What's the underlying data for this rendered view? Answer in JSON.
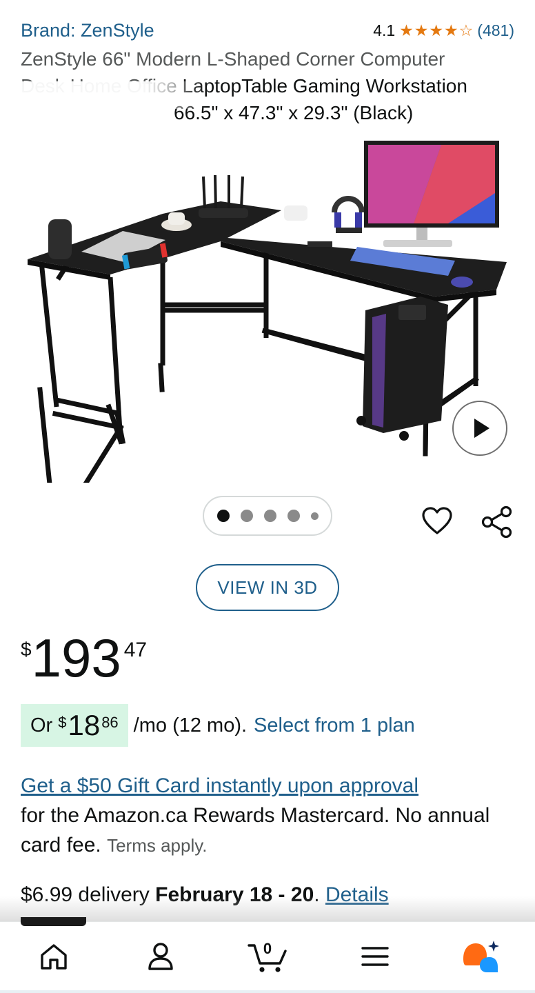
{
  "header": {
    "brand_link": "Brand: ZenStyle",
    "rating_value": "4.1",
    "rating_stars": 4.1,
    "rating_count": "(481)",
    "title_line1": "ZenStyle 66\" Modern L-Shaped Corner Computer",
    "title_line2_grey": "Desk Home Office ",
    "title_line2_dark": "LaptopTable Gaming Workstation",
    "title_line3": "66.5\" x 47.3\" x 29.3\" (Black)"
  },
  "gallery": {
    "image_icon": "l-shaped-desk-product-image",
    "play_icon": "play-icon",
    "dots_total": 5,
    "dots_active_index": 0,
    "favorite_icon": "heart-icon",
    "share_icon": "share-icon",
    "view_3d_label": "VIEW IN 3D"
  },
  "price": {
    "currency": "$",
    "whole": "193",
    "fraction": "47"
  },
  "installment": {
    "or_label": "Or",
    "currency": "$",
    "whole": "18",
    "fraction": "86",
    "term_text": "/mo (12 mo).",
    "plan_link": "Select from 1 plan"
  },
  "gift_card": {
    "link_text": "Get a $50 Gift Card instantly upon approval",
    "body_text": "for the Amazon.ca Rewards Mastercard. No annual card fee.",
    "terms_text": "Terms apply."
  },
  "delivery": {
    "price_text": "$6.99 delivery",
    "dates": "February 18 - 20",
    "period": ".",
    "details_link": "Details"
  },
  "bottom_nav": {
    "items": [
      {
        "icon": "home-icon"
      },
      {
        "icon": "account-icon"
      },
      {
        "icon": "cart-icon",
        "count": "0"
      },
      {
        "icon": "menu-icon"
      },
      {
        "icon": "rufus-ai-icon"
      }
    ]
  },
  "colors": {
    "link": "#1f5f8b",
    "star": "#e47911",
    "installment_bg": "#d7f5e4",
    "ai_orange": "#ff6a13",
    "ai_blue": "#1a98ff"
  }
}
